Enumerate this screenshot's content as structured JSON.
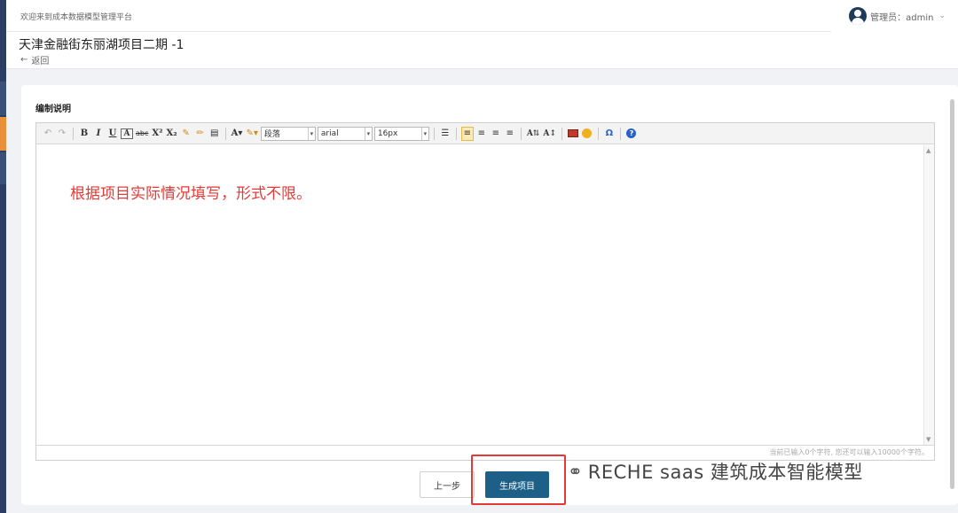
{
  "topbar": {
    "welcome": "欢迎来到成本数据模型管理平台",
    "user_label": "管理员：admin"
  },
  "header": {
    "title": "天津金融街东丽湖项目二期 -1",
    "back_label": "返回"
  },
  "form": {
    "section_label": "编制说明"
  },
  "toolbar": {
    "paragraph_select": "段落",
    "font_select": "arial",
    "size_select": "16px"
  },
  "editor": {
    "content_text": "根据项目实际情况填写，形式不限。",
    "status_text": "当前已输入0个字符, 您还可以输入10000个字符。"
  },
  "actions": {
    "prev_label": "上一步",
    "generate_label": "生成项目"
  },
  "watermark": {
    "text": "RECHE saas 建筑成本智能模型"
  },
  "colors": {
    "primary_button": "#1d5f86",
    "hint_text": "#e53935",
    "highlight_box": "#e53935",
    "sidebar": "#2c3e63",
    "sidebar_active": "#e8903a"
  }
}
